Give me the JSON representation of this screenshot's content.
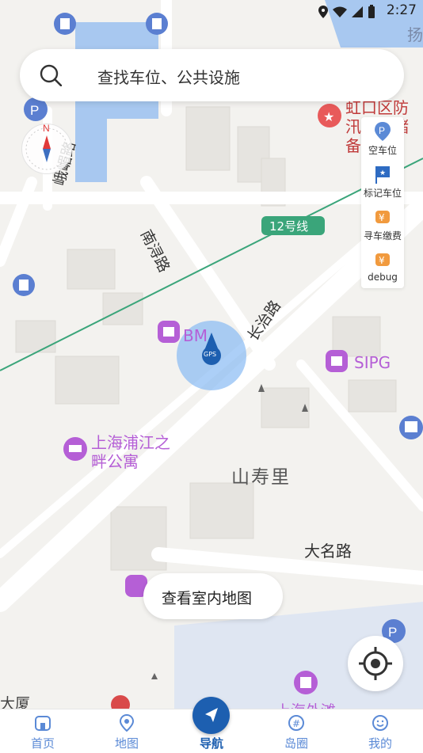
{
  "status_bar": {
    "time": "2:27",
    "icons": [
      "location-icon",
      "wifi-icon",
      "signal-icon",
      "battery-icon"
    ]
  },
  "search": {
    "placeholder": "查找车位、公共设施"
  },
  "compass": {
    "north_label": "N"
  },
  "side_panel": {
    "items": [
      {
        "label": "空车位",
        "icon": "parking-pin-icon"
      },
      {
        "label": "标记车位",
        "icon": "flag-icon"
      },
      {
        "label": "寻车缴费",
        "icon": "yen-pay-icon"
      },
      {
        "label": "debug",
        "icon": "yen-debug-icon"
      }
    ]
  },
  "map": {
    "labels": {
      "hongkou": "虹口区防汛物资储备中",
      "line12": "12号线",
      "nanxun_road": "南浔路",
      "emei_road": "峨嵋路",
      "changzhi_road": "长治路",
      "bm": "BM",
      "gps": "GPS",
      "sipg": "SIPG",
      "apartment": "上海浦江之畔公寓",
      "shanshouli": "山寿里",
      "daming_road": "大名路",
      "dasha": "大厦",
      "waitan": "上海外滩",
      "top_right": "扬"
    },
    "colors": {
      "water": "#a8c8f0",
      "road": "#ffffff",
      "block": "#e9e7e3",
      "rail_line": "#3aa57a",
      "accent": "#1d5fb0",
      "poi_purple": "#b55fd6"
    }
  },
  "indoor_button": {
    "label": "查看室内地图"
  },
  "tabbar": {
    "tabs": [
      {
        "label": "首页",
        "icon": "home-icon"
      },
      {
        "label": "地图",
        "icon": "map-pin-icon"
      },
      {
        "label": "导航",
        "icon": "navigate-icon"
      },
      {
        "label": "岛圈",
        "icon": "island-icon"
      },
      {
        "label": "我的",
        "icon": "profile-icon"
      }
    ]
  }
}
